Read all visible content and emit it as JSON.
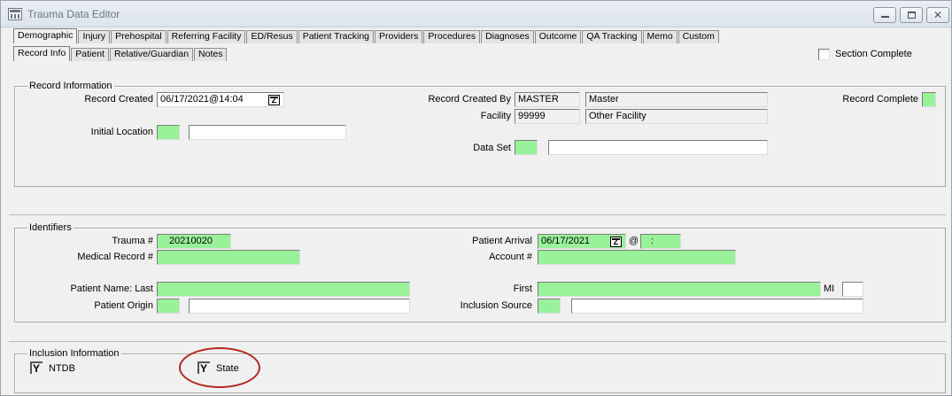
{
  "window": {
    "title": "Trauma Data Editor"
  },
  "main_tabs": [
    "Demographic",
    "Injury",
    "Prehospital",
    "Referring Facility",
    "ED/Resus",
    "Patient Tracking",
    "Providers",
    "Procedures",
    "Diagnoses",
    "Outcome",
    "QA Tracking",
    "Memo",
    "Custom"
  ],
  "sub_tabs": [
    "Record Info",
    "Patient",
    "Relative/Guardian",
    "Notes"
  ],
  "section_complete": "Section Complete",
  "record_info": {
    "title": "Record Information",
    "record_created_label": "Record Created",
    "record_created_value": "06/17/2021@14:04",
    "calendar_glyph": "Z",
    "created_by_label": "Record Created By",
    "created_by_code": "MASTER",
    "created_by_name": "Master",
    "facility_label": "Facility",
    "facility_code": "99999",
    "facility_name": "Other Facility",
    "record_complete_label": "Record Complete",
    "initial_location_label": "Initial Location",
    "data_set_label": "Data Set"
  },
  "identifiers": {
    "title": "Identifiers",
    "trauma_label": "Trauma #",
    "trauma_value": "20210020",
    "medical_record_label": "Medical Record #",
    "patient_arrival_label": "Patient Arrival",
    "patient_arrival_date": "06/17/2021",
    "at_symbol": "@",
    "patient_arrival_time": ":",
    "account_label": "Account #",
    "patient_name_last_label": "Patient Name: Last",
    "first_label": "First",
    "mi_label": "MI",
    "patient_origin_label": "Patient Origin",
    "inclusion_source_label": "Inclusion Source"
  },
  "inclusion": {
    "title": "Inclusion Information",
    "check_glyph": "Y",
    "ntdb_label": "NTDB",
    "state_label": "State"
  },
  "colors": {
    "required_field": "#99f299",
    "annotation_circle": "#b3261e"
  }
}
